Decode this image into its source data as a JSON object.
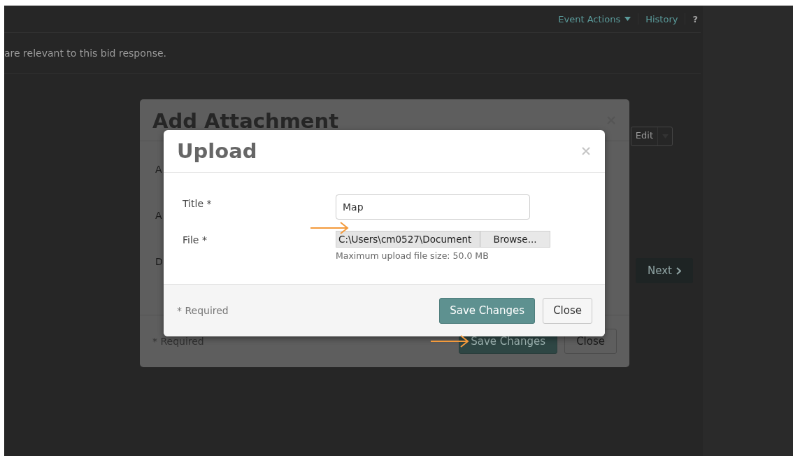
{
  "page": {
    "header_links": [
      {
        "label": "Event Actions",
        "kind": "dropdown"
      },
      {
        "label": "History",
        "kind": "link"
      },
      {
        "label": "?",
        "kind": "link"
      }
    ],
    "intro_text": "are relevant to this bid response.",
    "edit_button": "Edit",
    "next_button": "Next"
  },
  "add_attachment_dialog": {
    "title": "Add Attachment",
    "field_labels": [
      "A",
      "A",
      "D"
    ],
    "required_note": "* Required",
    "buttons": [
      {
        "label": "Save Changes",
        "primary": true
      },
      {
        "label": "Close",
        "primary": false
      }
    ]
  },
  "upload_dialog": {
    "title": "Upload",
    "fields": [
      {
        "label": "Title *",
        "kind": "text",
        "value": "Map"
      },
      {
        "label": "File *",
        "kind": "file",
        "value": "C:\\Users\\cm0527\\Document",
        "button": "Browse...",
        "help": "Maximum upload file size: 50.0 MB"
      }
    ],
    "required_note": "* Required",
    "buttons": [
      {
        "label": "Save Changes",
        "primary": true
      },
      {
        "label": "Close",
        "primary": false
      }
    ]
  }
}
